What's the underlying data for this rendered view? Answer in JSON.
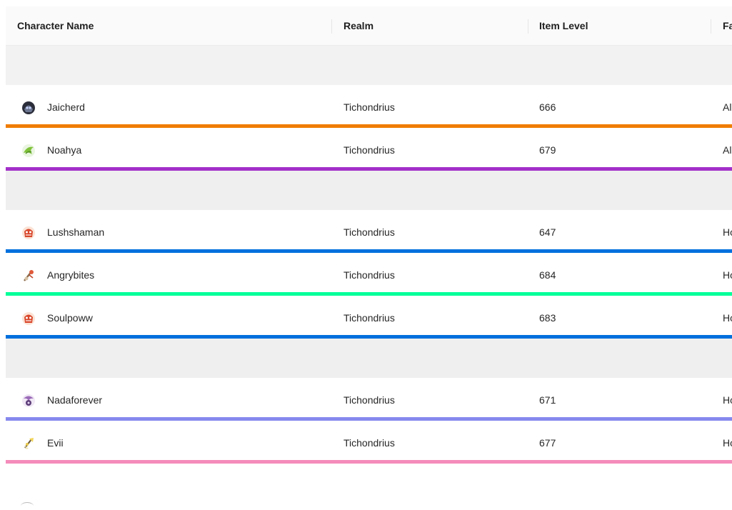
{
  "columns": {
    "name": "Character Name",
    "realm": "Realm",
    "item_level": "Item Level",
    "faction": "Fa"
  },
  "rows": [
    {
      "name": "Jaicherd",
      "realm": "Tichondrius",
      "item_level": "666",
      "faction": "Al",
      "bar_color": "#f07c00",
      "icon": "death-knight-icon"
    },
    {
      "name": "Noahya",
      "realm": "Tichondrius",
      "item_level": "679",
      "faction": "Al",
      "bar_color": "#a330c9",
      "icon": "demon-hunter-icon"
    },
    {
      "name": "Lushshaman",
      "realm": "Tichondrius",
      "item_level": "647",
      "faction": "Ho",
      "bar_color": "#0070dd",
      "icon": "shaman-icon"
    },
    {
      "name": "Angrybites",
      "realm": "Tichondrius",
      "item_level": "684",
      "faction": "Ho",
      "bar_color": "#00ff98",
      "icon": "monk-icon"
    },
    {
      "name": "Soulpoww",
      "realm": "Tichondrius",
      "item_level": "683",
      "faction": "Ho",
      "bar_color": "#0070dd",
      "icon": "shaman-icon"
    },
    {
      "name": "Nadaforever",
      "realm": "Tichondrius",
      "item_level": "671",
      "faction": "Ho",
      "bar_color": "#8788ee",
      "icon": "warlock-icon"
    },
    {
      "name": "Evii",
      "realm": "Tichondrius",
      "item_level": "677",
      "faction": "Ho",
      "bar_color": "#f48cba",
      "icon": "paladin-icon"
    }
  ]
}
